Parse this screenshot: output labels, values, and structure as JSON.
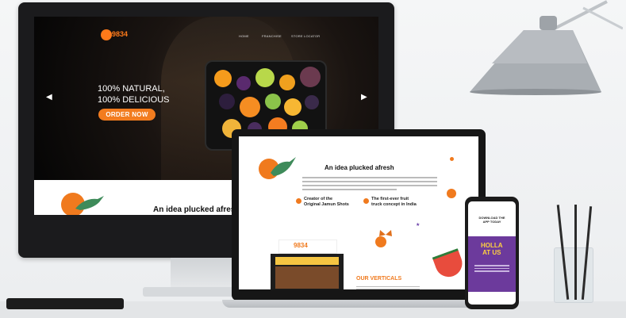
{
  "monitor_site": {
    "logo": "9834",
    "nav": [
      "HOME",
      "FRANCHISE",
      "STORE LOCATOR"
    ],
    "hero_line1": "100% NATURAL,",
    "hero_line2": "100% DELICIOUS",
    "order_button": "ORDER NOW",
    "prev_arrow": "◀",
    "next_arrow": "▶",
    "section_heading": "An idea plucked afresh"
  },
  "laptop_site": {
    "section_heading": "An idea plucked afresh",
    "feature1": [
      "Creator of the",
      "Original Jamun Shots"
    ],
    "feature2": [
      "The first-ever fruit",
      "truck concept in India"
    ],
    "verticals_heading": "OUR VERTICALS",
    "truck_logo": "9834"
  },
  "phone_site": {
    "top_text": "DOWNLOAD THE APP TODAY",
    "holla_line1": "HOLLA",
    "holla_line2": "AT US"
  },
  "colors": {
    "brand_orange": "#f27c1f",
    "purple": "#6c3a9c",
    "dark": "#0b0b0b"
  }
}
